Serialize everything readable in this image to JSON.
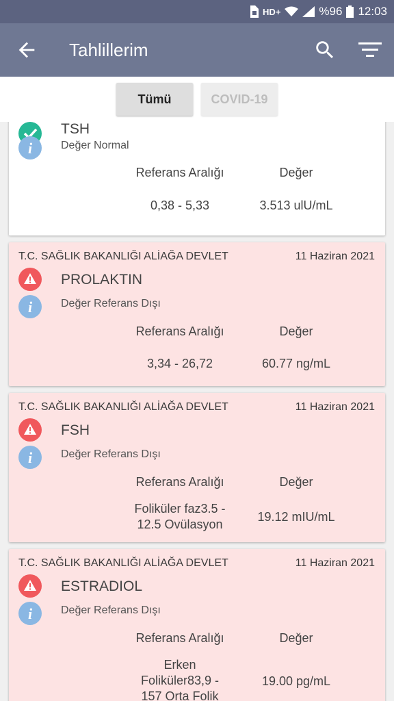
{
  "status_bar": {
    "network": "HD+",
    "battery": "%96",
    "time": "12:03"
  },
  "app_bar": {
    "title": "Tahlillerim",
    "back_icon": "arrow-left-icon",
    "search_icon": "search-icon",
    "filter_icon": "filter-icon"
  },
  "tabs": [
    {
      "label": "Tümü",
      "active": true
    },
    {
      "label": "COVID-19",
      "active": false
    }
  ],
  "column_headers": {
    "reference": "Referans Aralığı",
    "value": "Değer"
  },
  "colors": {
    "status_bar": "#5c6380",
    "app_bar": "#6f7893",
    "alert_card": "#fde3e3",
    "normal_icon": "#26b895",
    "alert_icon": "#f0585c",
    "info_icon": "#8ab7e3"
  },
  "results": [
    {
      "test": "TSH",
      "status": "Değer Normal",
      "reference": "0,38 - 5,33",
      "value": "3.513 ulU/mL",
      "state": "normal"
    },
    {
      "hospital": "T.C. SAĞLIK BAKANLIĞI ALİAĞA DEVLET",
      "date": "11 Haziran 2021",
      "test": "PROLAKTIN",
      "status": "Değer Referans Dışı",
      "reference": "3,34 - 26,72",
      "value": "60.77 ng/mL",
      "state": "alert"
    },
    {
      "hospital": "T.C. SAĞLIK BAKANLIĞI ALİAĞA DEVLET",
      "date": "11 Haziran 2021",
      "test": "FSH",
      "status": "Değer Referans Dışı",
      "reference_lines": [
        "Foliküler faz3.5 -",
        "12.5 Ovülasyon"
      ],
      "value": "19.12 mIU/mL",
      "state": "alert"
    },
    {
      "hospital": "T.C. SAĞLIK BAKANLIĞI ALİAĞA DEVLET",
      "date": "11 Haziran 2021",
      "test": "ESTRADIOL",
      "status": "Değer Referans Dışı",
      "reference_lines": [
        "Erken",
        "Foliküler83,9 -",
        "157 Orta Folik"
      ],
      "value": "19.00 pg/mL",
      "state": "alert"
    }
  ]
}
